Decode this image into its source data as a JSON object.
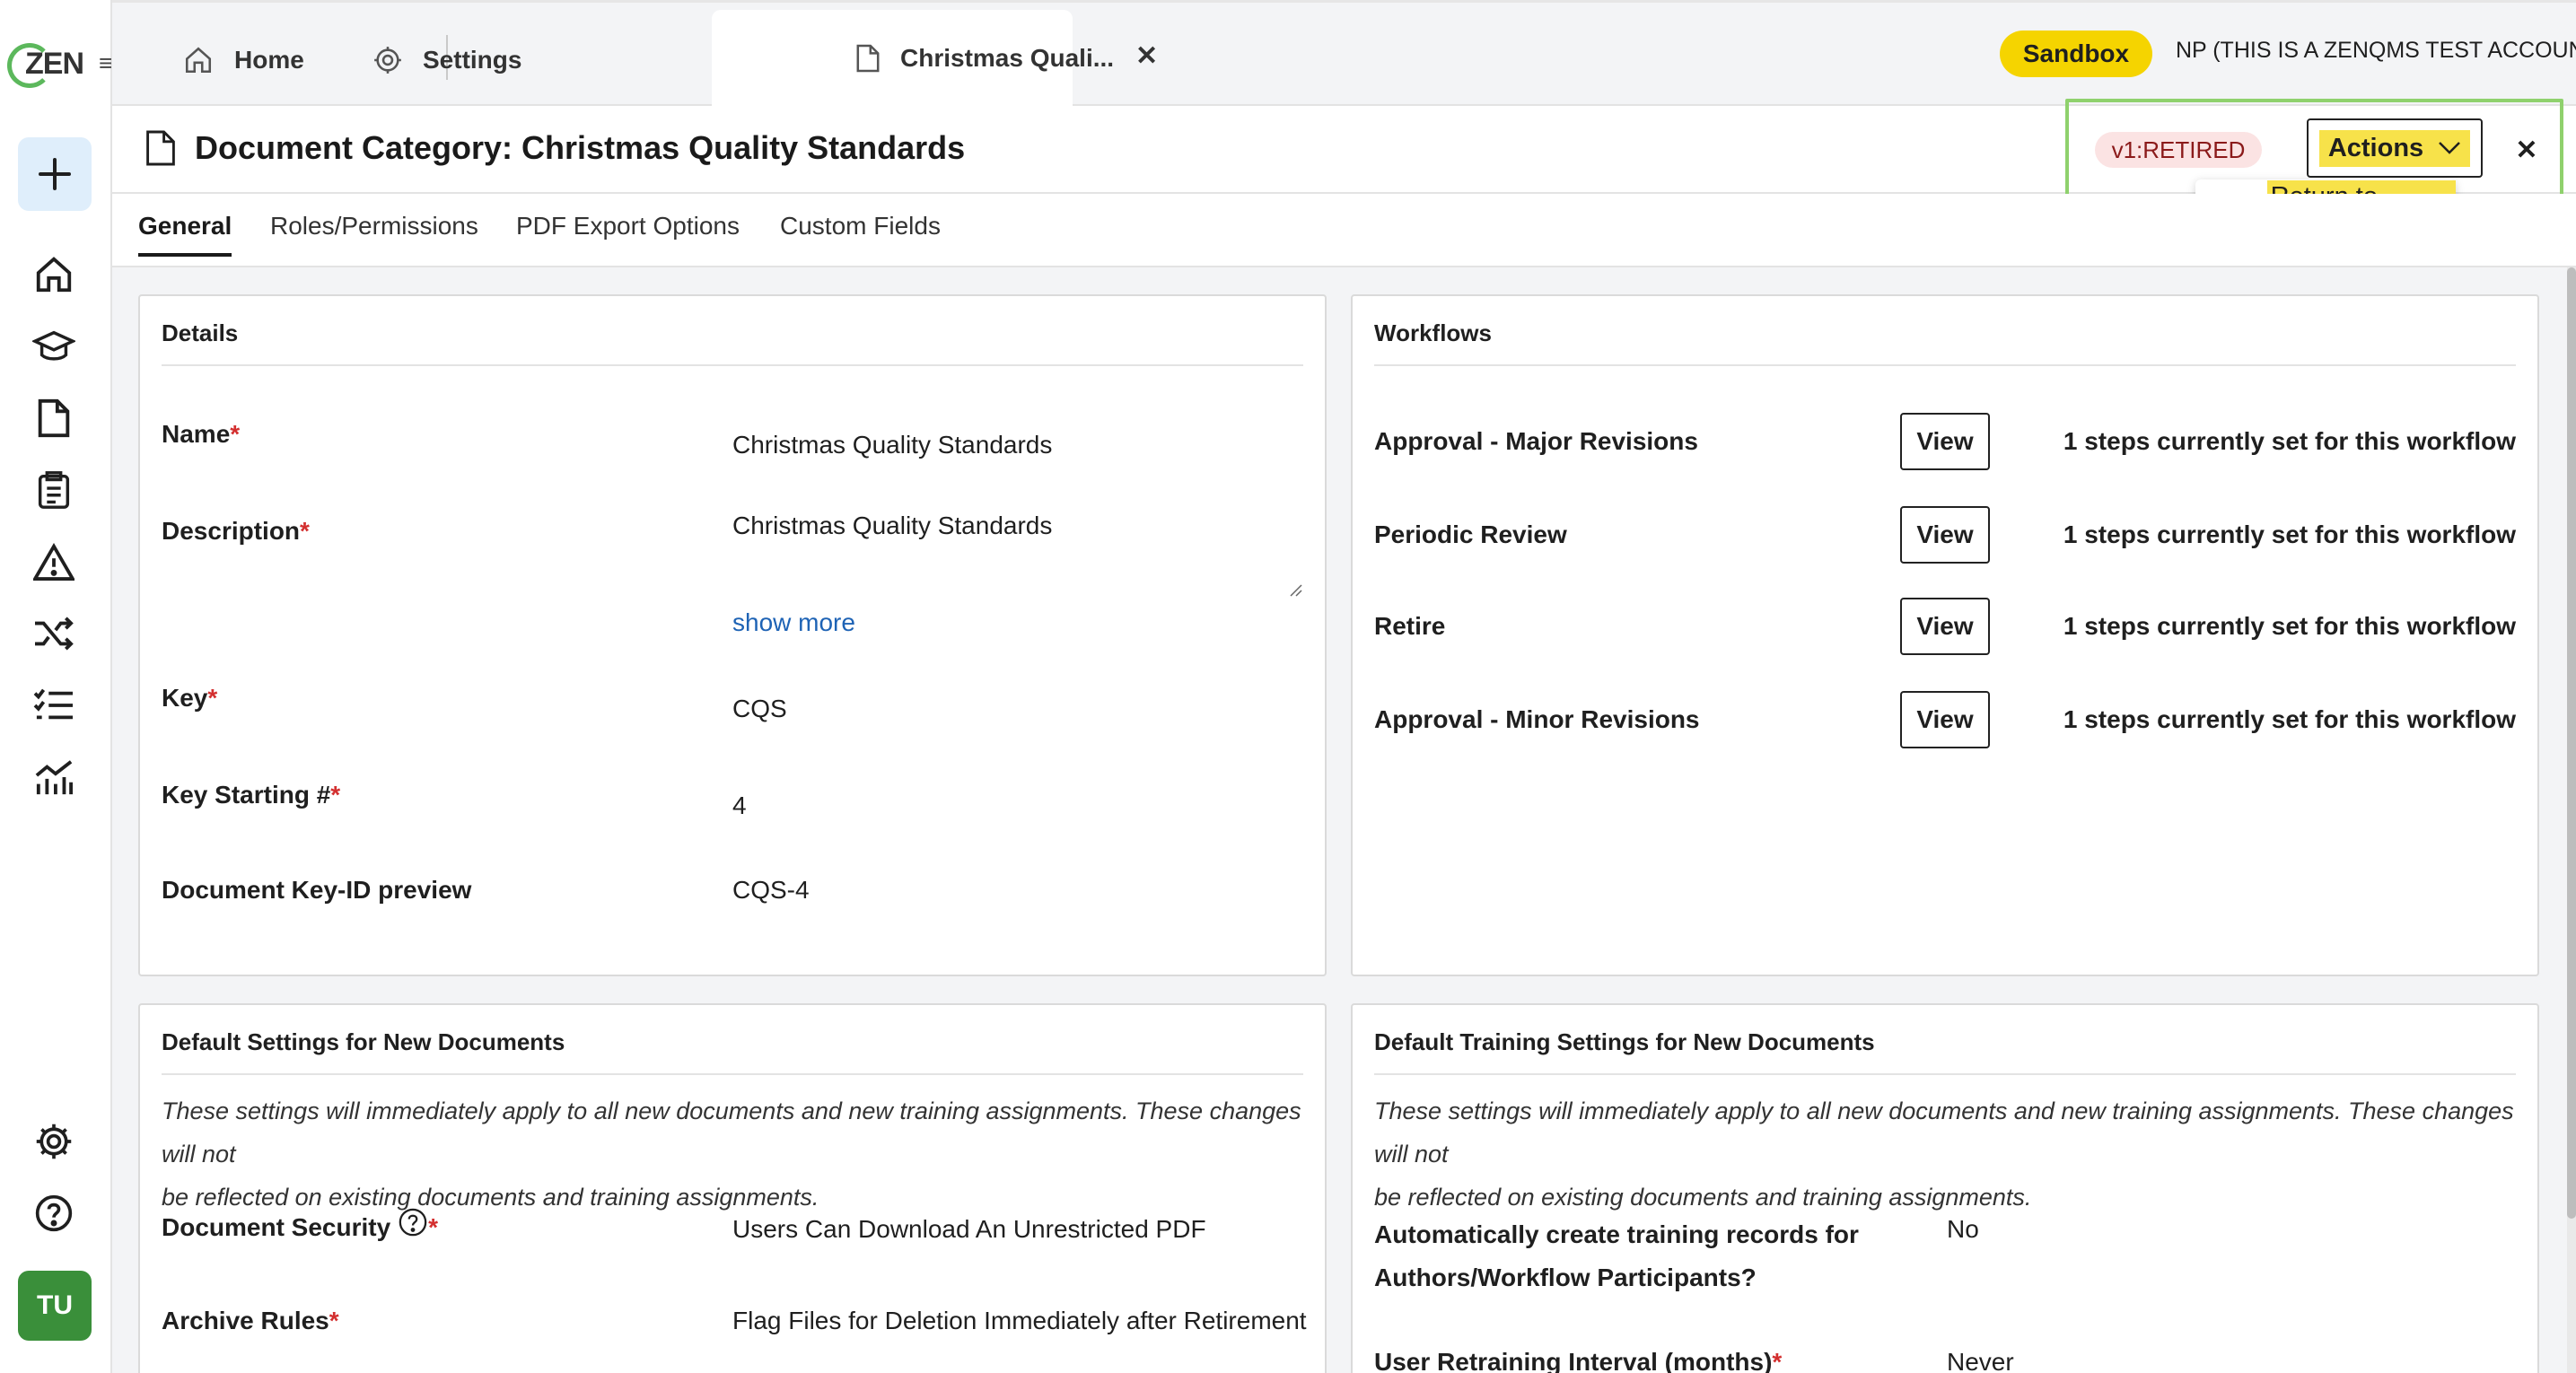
{
  "rail": {
    "logo_text": "ZEN",
    "avatar_initials": "TU",
    "icons": [
      "plus-icon",
      "home-icon",
      "training-icon",
      "document-icon",
      "clipboard-icon",
      "warning-icon",
      "shuffle-icon",
      "checklist-icon",
      "analytics-icon",
      "settings-icon",
      "help-icon"
    ]
  },
  "tabs": [
    {
      "label": "Home",
      "icon": "home-icon"
    },
    {
      "label": "Settings",
      "icon": "gear-icon"
    },
    {
      "label": "Christmas Quali...",
      "icon": "document-icon",
      "active": true
    }
  ],
  "topbar": {
    "sandbox_label": "Sandbox",
    "account_label": "NP (THIS IS A ZENQMS TEST ACCOUNT)"
  },
  "header": {
    "title": "Document Category: Christmas Quality Standards",
    "status": "v1:RETIRED",
    "actions_label": "Actions",
    "dropdown_item": "Return to Active"
  },
  "subtabs": [
    "General",
    "Roles/Permissions",
    "PDF Export Options",
    "Custom Fields"
  ],
  "details": {
    "title": "Details",
    "fields": [
      {
        "label": "Name",
        "required": "*",
        "value": "Christmas Quality Standards"
      },
      {
        "label": "Description",
        "required": "*",
        "value": "Christmas Quality Standards"
      },
      {
        "label": "Key",
        "required": "*",
        "value": "CQS"
      },
      {
        "label": "Key Starting #",
        "required": "*",
        "value": "4"
      },
      {
        "label": "Document Key-ID preview",
        "required": "",
        "value": "CQS-4"
      }
    ],
    "show_more": "show more"
  },
  "workflows": {
    "title": "Workflows",
    "view_label": "View",
    "rows": [
      {
        "name": "Approval - Major Revisions",
        "info": "1 steps currently set for this workflow"
      },
      {
        "name": "Periodic Review",
        "info": "1 steps currently set for this workflow"
      },
      {
        "name": "Retire",
        "info": "1 steps currently set for this workflow"
      },
      {
        "name": "Approval - Minor Revisions",
        "info": "1 steps currently set for this workflow"
      }
    ]
  },
  "defaults": {
    "title": "Default Settings for New Documents",
    "note_line1": "These settings will immediately apply to all new documents and new training assignments. These changes will not",
    "note_line2": "be reflected on existing documents and training assignments.",
    "fields": [
      {
        "label": "Document Security",
        "required": "*",
        "value": "Users Can Download An Unrestricted PDF"
      },
      {
        "label": "Archive Rules",
        "required": "*",
        "value": "Flag Files for Deletion Immediately after Retirement"
      }
    ]
  },
  "training": {
    "title": "Default Training Settings for New Documents",
    "note_line1": "These settings will immediately apply to all new documents and new training assignments. These changes will not",
    "note_line2": "be reflected on existing documents and training assignments.",
    "fields": [
      {
        "label_line1": "Automatically create training records for",
        "label_line2": "Authors/Workflow Participants?",
        "value": "No"
      },
      {
        "label": "User Retraining Interval (months)",
        "required": "*",
        "value": "Never"
      }
    ]
  },
  "colors": {
    "accent_yellow": "#f5d400",
    "retired_bg": "#fbe3e3",
    "retired_text": "#8b1a1a",
    "link": "#1e63b5",
    "avatar_green": "#3a8f3a"
  }
}
